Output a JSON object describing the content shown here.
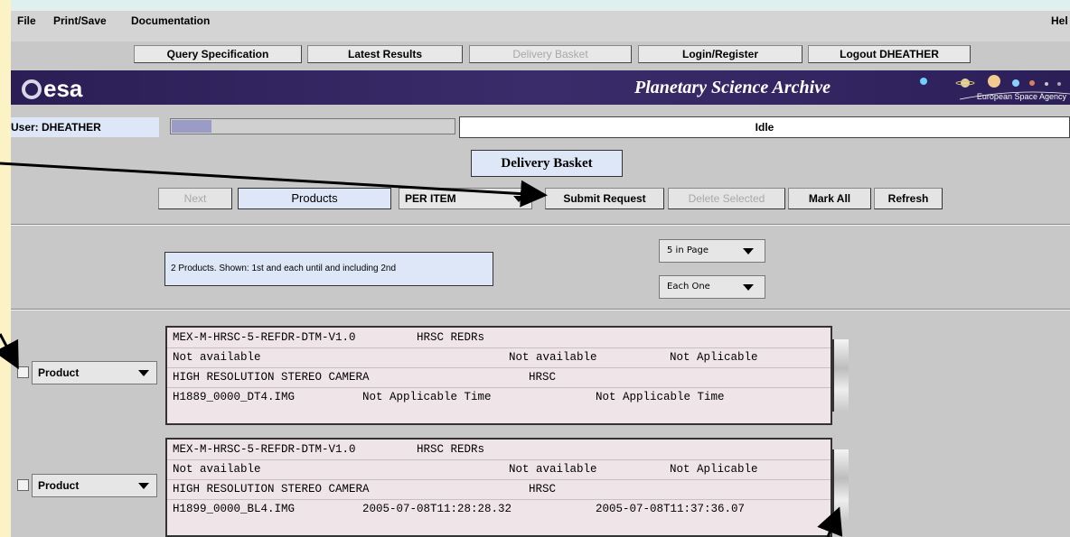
{
  "menu": {
    "file": "File",
    "print_save": "Print/Save",
    "documentation": "Documentation",
    "help": "Hel"
  },
  "nav": {
    "query_spec": "Query Specification",
    "latest_results": "Latest Results",
    "delivery_basket": "Delivery Basket",
    "login_register": "Login/Register",
    "logout": "Logout DHEATHER"
  },
  "banner": {
    "logo_text": "esa",
    "title": "Planetary Science  Archive",
    "agency": "European Space Agency"
  },
  "user": {
    "label": "User: DHEATHER",
    "status": "Idle",
    "progress": 0.14
  },
  "basket": {
    "title": "Delivery Basket"
  },
  "toolbar": {
    "next": "Next",
    "products": "Products",
    "per_item": "PER ITEM",
    "submit": "Submit Request",
    "delete_selected": "Delete Selected",
    "mark_all": "Mark All",
    "refresh": "Refresh"
  },
  "summary": {
    "text": "2 Products. Shown: 1st  and each until and including  2nd",
    "page_size": "5 in Page",
    "step": "Each One"
  },
  "products": [
    {
      "type": "Product",
      "dataset": "MEX-M-HRSC-5-REFDR-DTM-V1.0",
      "dataset_name": "HRSC REDRs",
      "target_a": "Not available",
      "target_b": "Not available",
      "target_c": "Not Aplicable",
      "instrument": "HIGH RESOLUTION STEREO CAMERA",
      "instrument_id": "HRSC",
      "file": "H1889_0000_DT4.IMG",
      "start_time": "Not Applicable Time",
      "stop_time": "Not Applicable Time"
    },
    {
      "type": "Product",
      "dataset": "MEX-M-HRSC-5-REFDR-DTM-V1.0",
      "dataset_name": "HRSC REDRs",
      "target_a": "Not available",
      "target_b": "Not available",
      "target_c": "Not Aplicable",
      "instrument": "HIGH RESOLUTION STEREO CAMERA",
      "instrument_id": "HRSC",
      "file": "H1899_0000_BL4.IMG",
      "start_time": "2005-07-08T11:28:28.32",
      "stop_time": "2005-07-08T11:37:36.07"
    }
  ],
  "colors": {
    "banner": "#2b1e55",
    "highlight": "#dde7f7",
    "card": "#efe4e8",
    "sidebar": "#fbf3c6"
  }
}
